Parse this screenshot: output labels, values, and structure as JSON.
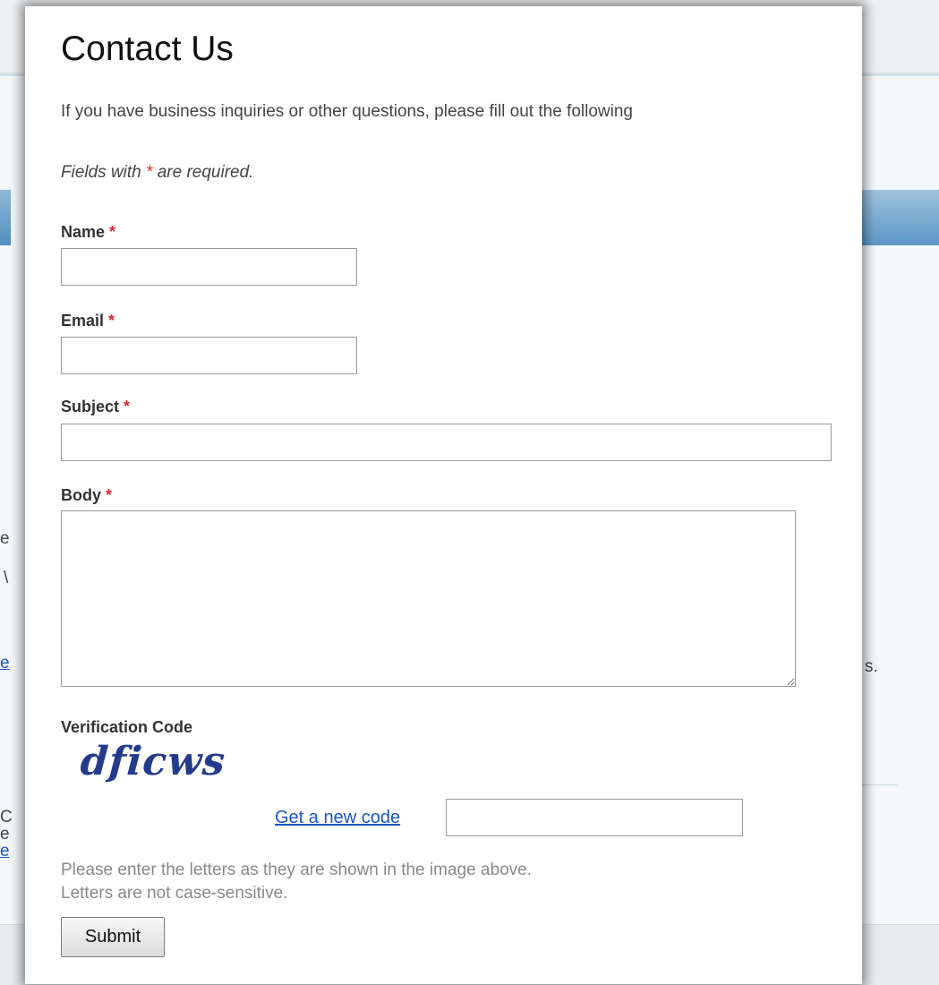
{
  "background": {
    "fragments_left": [
      "e",
      "\\",
      "e",
      "C",
      "e",
      "e"
    ],
    "fragment_right": "s."
  },
  "form": {
    "title": "Contact Us",
    "intro": "If you have business inquiries or other questions, please fill out the following",
    "required_note_prefix": "Fields with",
    "required_marker": "*",
    "required_note_suffix": "are required.",
    "fields": {
      "name": {
        "label": "Name",
        "value": "",
        "placeholder": ""
      },
      "email": {
        "label": "Email",
        "value": "",
        "placeholder": ""
      },
      "subject": {
        "label": "Subject",
        "value": "",
        "placeholder": ""
      },
      "body": {
        "label": "Body",
        "value": "",
        "placeholder": ""
      }
    },
    "verification": {
      "label": "Verification Code",
      "captcha_text": "dficws",
      "new_code_link": "Get a new code",
      "value": "",
      "hint_line1": "Please enter the letters as they are shown in the image above.",
      "hint_line2": "Letters are not case-sensitive."
    },
    "submit_label": "Submit"
  },
  "colors": {
    "required_star": "#e0262e",
    "link": "#1a55c7",
    "captcha": "#243b8c"
  }
}
